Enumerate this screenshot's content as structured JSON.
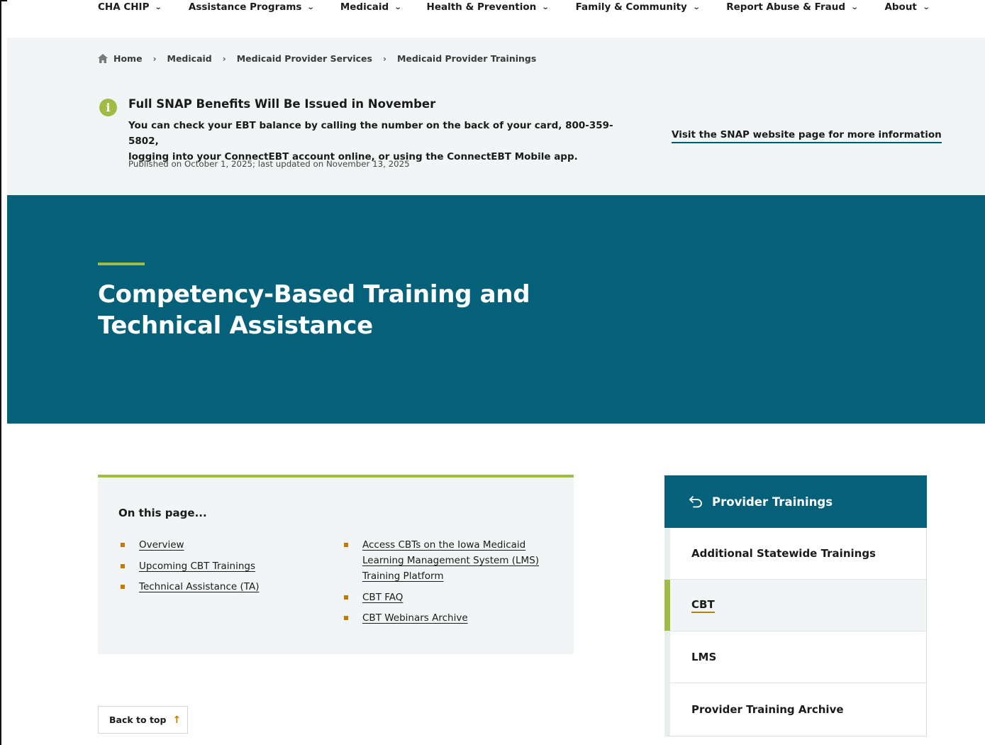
{
  "nav": {
    "items": [
      {
        "label": "CHA CHIP"
      },
      {
        "label": "Assistance Programs"
      },
      {
        "label": "Medicaid"
      },
      {
        "label": "Health & Prevention"
      },
      {
        "label": "Family & Community"
      },
      {
        "label": "Report Abuse & Fraud"
      },
      {
        "label": "About"
      }
    ]
  },
  "breadcrumb": {
    "items": [
      "Home",
      "Medicaid",
      "Medicaid Provider Services",
      "Medicaid Provider Trainings"
    ]
  },
  "alert": {
    "title": "Full SNAP Benefits Will Be Issued in November",
    "body_line1": "You can check your EBT balance by calling the number on the back of your card, 800-359-5802,",
    "body_line2": "logging into your ConnectEBT account online, or using the ConnectEBT Mobile app.",
    "meta": "Published on October 1, 2025; last updated on November 13, 2025",
    "link": "Visit the SNAP website page for more information"
  },
  "hero": {
    "title_line1": "Competency-Based Training and",
    "title_line2": "Technical Assistance"
  },
  "on_this_page": {
    "heading": "On this page...",
    "col1": [
      "Overview",
      "Upcoming CBT Trainings",
      "Technical Assistance (TA)"
    ],
    "col2": [
      "Access CBTs on the Iowa Medicaid Learning Management System (LMS) Training Platform",
      "CBT FAQ",
      "CBT Webinars Archive"
    ]
  },
  "back_to_top": {
    "label": "Back to top"
  },
  "sidebar": {
    "title": "Provider Trainings",
    "items": [
      {
        "label": "Additional Statewide Trainings"
      },
      {
        "label": "CBT"
      },
      {
        "label": "LMS"
      },
      {
        "label": "Provider Training Archive"
      }
    ],
    "active_index": 1
  },
  "colors": {
    "teal": "#05617a",
    "accent_green": "#9fbc45",
    "bullet_orange": "#c47a00",
    "band": "#f1f5f5"
  }
}
